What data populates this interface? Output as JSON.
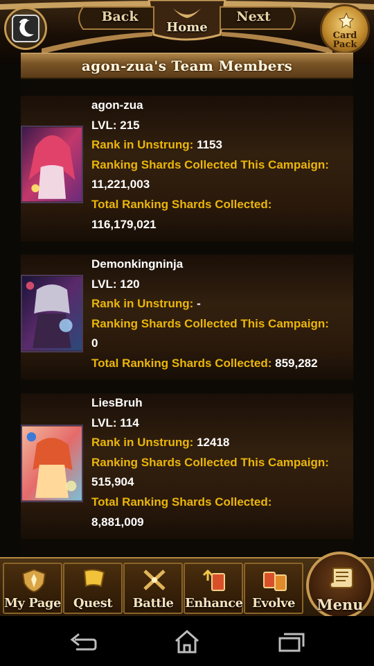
{
  "header": {
    "back_label": "Back",
    "home_label": "Home",
    "next_label": "Next",
    "card_pack_label_1": "Card",
    "card_pack_label_2": "Pack",
    "app_icon": "app-logo-icon"
  },
  "title": "agon-zua's Team Members",
  "labels": {
    "lvl": "LVL:",
    "rank": "Rank in Unstrung:",
    "campaign": "Ranking Shards Collected This Campaign:",
    "total": "Total Ranking Shards Collected:"
  },
  "members": [
    {
      "name": "agon-zua",
      "lvl": "215",
      "rank": "1153",
      "campaign_shards": "11,221,003",
      "total_shards": "116,179,021"
    },
    {
      "name": "Demonkingninja",
      "lvl": "120",
      "rank": "-",
      "campaign_shards": "0",
      "total_shards": "859,282"
    },
    {
      "name": "LiesBruh",
      "lvl": "114",
      "rank": "12418",
      "campaign_shards": "515,904",
      "total_shards": "8,881,009"
    }
  ],
  "menu": {
    "my_page": "My Page",
    "quest": "Quest",
    "battle": "Battle",
    "enhance": "Enhance",
    "evolve": "Evolve",
    "menu": "Menu"
  },
  "colors": {
    "label_gold": "#ebb60a",
    "value_white": "#ffffff",
    "title_bar": "#7a5526",
    "frame_gold": "#c59a52"
  }
}
